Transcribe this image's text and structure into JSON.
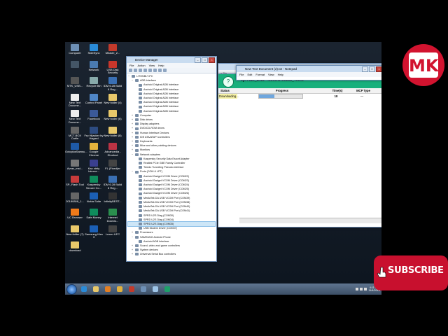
{
  "desktop_icons": [
    {
      "label": "Computer",
      "color": "#6d8fb5"
    },
    {
      "label": "SideSync",
      "color": "#2a8bd8"
    },
    {
      "label": "Miracle_2...",
      "color": "#c23a2b"
    },
    {
      "label": "",
      "color": "#445566"
    },
    {
      "label": "Network",
      "color": "#4a7ab0"
    },
    {
      "label": "USB Disk Security",
      "color": "#c8362b"
    },
    {
      "label": "MTK_USB...",
      "color": "#555"
    },
    {
      "label": "Recycle Bin",
      "color": "#8aa"
    },
    {
      "label": "IDM 6.28 Build 8 Reg...",
      "color": "#3a6fb3"
    },
    {
      "label": "New Text Docume...",
      "color": "#eee"
    },
    {
      "label": "Control Panel",
      "color": "#4f86c6"
    },
    {
      "label": "New folder (4)",
      "color": "#e8c86a"
    },
    {
      "label": "New Text Docume...",
      "color": "#eee"
    },
    {
      "label": "Facebook",
      "color": "#3b5998"
    },
    {
      "label": "New folder (6)",
      "color": "#e8c86a"
    },
    {
      "label": "MCT-BOX Cable",
      "color": "#666"
    },
    {
      "label": "Frp Hijacker by Hagard",
      "color": "#2d4b80"
    },
    {
      "label": "New folder (8)",
      "color": "#e8c86a"
    },
    {
      "label": "OctoplusSamsu...",
      "color": "#1e5aa8"
    },
    {
      "label": "Google Chrome",
      "color": "#e3b23c"
    },
    {
      "label": "Advancedia - Shortcut",
      "color": "#bb3344"
    },
    {
      "label": "Avraz_mst...",
      "color": "#777"
    },
    {
      "label": "Kaz xtrity Interne...",
      "color": "#3a3f8f"
    },
    {
      "label": "FL (Fixed)er",
      "color": "#444"
    },
    {
      "label": "SP_Flash Tool",
      "color": "#c73b3b"
    },
    {
      "label": "Kaspersky Secure Co...",
      "color": "#0f8c5c"
    },
    {
      "label": "IDM 6.28 Build 8 Reg...",
      "color": "#3a6fb3"
    },
    {
      "label": "20180808_1...",
      "color": "#666"
    },
    {
      "label": "Nokia Suite",
      "color": "#1b5fb5"
    },
    {
      "label": "InfinityBEST...",
      "color": "#333"
    },
    {
      "label": "UC Browser",
      "color": "#f07a1a"
    },
    {
      "label": "Safe Money",
      "color": "#0f8c5c"
    },
    {
      "label": "Internet Downlo...",
      "color": "#2a8f4e"
    },
    {
      "label": "New folder (7)",
      "color": "#e8c86a"
    },
    {
      "label": "Samsung Kies 3",
      "color": "#1b5fb5"
    },
    {
      "label": "Lexen UFC",
      "color": "#444"
    },
    {
      "label": "download",
      "color": "#e8c86a"
    }
  ],
  "device_manager": {
    "title": "Device Manager",
    "menus": [
      "File",
      "Action",
      "View",
      "Help"
    ],
    "tree": [
      {
        "label": "LITONBLT-PC",
        "indent": 0,
        "exp": "−"
      },
      {
        "label": "ADB Interface",
        "indent": 1,
        "exp": "−"
      },
      {
        "label": "Android Original ADB Interface",
        "indent": 2,
        "exp": ""
      },
      {
        "label": "Android Original ADB Interface",
        "indent": 2,
        "exp": ""
      },
      {
        "label": "Android Original ADB Interface",
        "indent": 2,
        "exp": ""
      },
      {
        "label": "Android Original ADB Interface",
        "indent": 2,
        "exp": ""
      },
      {
        "label": "Android Original ADB Interface",
        "indent": 2,
        "exp": ""
      },
      {
        "label": "Android Original ADB Interface",
        "indent": 2,
        "exp": ""
      },
      {
        "label": "Android Original ADB Interface",
        "indent": 2,
        "exp": ""
      },
      {
        "label": "Computer",
        "indent": 1,
        "exp": "+"
      },
      {
        "label": "Disk drives",
        "indent": 1,
        "exp": "+"
      },
      {
        "label": "Display adapters",
        "indent": 1,
        "exp": "+"
      },
      {
        "label": "DVD/CD-ROM drives",
        "indent": 1,
        "exp": "+"
      },
      {
        "label": "Human Interface Devices",
        "indent": 1,
        "exp": "+"
      },
      {
        "label": "IDE ATA/ATAPI controllers",
        "indent": 1,
        "exp": "+"
      },
      {
        "label": "Keyboards",
        "indent": 1,
        "exp": "+"
      },
      {
        "label": "Mice and other pointing devices",
        "indent": 1,
        "exp": "+"
      },
      {
        "label": "Monitors",
        "indent": 1,
        "exp": "+"
      },
      {
        "label": "Network adapters",
        "indent": 1,
        "exp": "−"
      },
      {
        "label": "Kaspersky Security Data Escort Adapter",
        "indent": 2,
        "exp": ""
      },
      {
        "label": "Realtek PCIe GBE Family Controller",
        "indent": 2,
        "exp": ""
      },
      {
        "label": "Teredo Tunneling Pseudo-Interface",
        "indent": 2,
        "exp": ""
      },
      {
        "label": "Ports (COM & LPT)",
        "indent": 1,
        "exp": "−"
      },
      {
        "label": "Android Gadget VCOM Driver (COM22)",
        "indent": 2,
        "exp": ""
      },
      {
        "label": "Android Gadget VCOM Driver (COM23)",
        "indent": 2,
        "exp": ""
      },
      {
        "label": "Android Gadget VCOM Driver (COM24)",
        "indent": 2,
        "exp": ""
      },
      {
        "label": "Android Gadget VCOM Driver (COM25)",
        "indent": 2,
        "exp": ""
      },
      {
        "label": "Android Gadget VCOM Driver (COM26)",
        "indent": 2,
        "exp": ""
      },
      {
        "label": "MediaTek DA USB VCOM Port (COM39)",
        "indent": 2,
        "exp": ""
      },
      {
        "label": "MediaTek DA USB VCOM Port (COM38)",
        "indent": 2,
        "exp": ""
      },
      {
        "label": "MediaTek DA USB VCOM Port (COM40)",
        "indent": 2,
        "exp": ""
      },
      {
        "label": "MediaTek DA USB VCOM Port (COM41)",
        "indent": 2,
        "exp": ""
      },
      {
        "label": "SPRD U2S Diag (COM30)",
        "indent": 2,
        "exp": ""
      },
      {
        "label": "SPRD U2S Diag (COM34)",
        "indent": 2,
        "exp": ""
      },
      {
        "label": "SPRD U2S Diag (COM35)",
        "indent": 2,
        "exp": "",
        "selected": true
      },
      {
        "label": "USB Modem Driver (COM37)",
        "indent": 2,
        "exp": ""
      },
      {
        "label": "Processors",
        "indent": 1,
        "exp": "+"
      },
      {
        "label": "SAMSUNG Android Phone",
        "indent": 1,
        "exp": "−"
      },
      {
        "label": "Android ADB Interface",
        "indent": 2,
        "exp": ""
      },
      {
        "label": "Sound, video and game controllers",
        "indent": 1,
        "exp": "+"
      },
      {
        "label": "System devices",
        "indent": 1,
        "exp": "+"
      },
      {
        "label": "Universal Serial Bus controllers",
        "indent": 1,
        "exp": "+"
      }
    ]
  },
  "notepad": {
    "title": "New Text Document (2).txt - Notepad",
    "menus": [
      "File",
      "Edit",
      "Format",
      "View",
      "Help"
    ]
  },
  "research_tool": {
    "firmware_label": "sp7731e_1h10 - MoxerDroid8.1_Trunk",
    "columns": [
      "Status",
      "Progress",
      "Time(s)",
      "MCP Type"
    ],
    "row": {
      "status": "Downloading...",
      "progress": 0.36,
      "time": "18",
      "mcp": "—"
    }
  },
  "background_window": {
    "nav_text": "« Bin"
  },
  "taskbar": {
    "apps": [
      {
        "name": "ie-icon",
        "color": "#2a8bd8"
      },
      {
        "name": "explorer-icon",
        "color": "#e8c86a"
      },
      {
        "name": "media-player-icon",
        "color": "#e37f23"
      },
      {
        "name": "chrome-icon",
        "color": "#e3b23c"
      },
      {
        "name": "tool-icon",
        "color": "#c23a2b"
      },
      {
        "name": "device-manager-icon",
        "color": "#6d8fb5"
      },
      {
        "name": "notepad-icon",
        "color": "#9ec5e8"
      },
      {
        "name": "research-tool-icon",
        "color": "#1ea06a"
      }
    ],
    "clock_time": "4:11 PM",
    "clock_date": "11/4/2018"
  },
  "brand_logo": {
    "text": "MK"
  },
  "subscribe": {
    "text": "SUBSCRIBE"
  }
}
